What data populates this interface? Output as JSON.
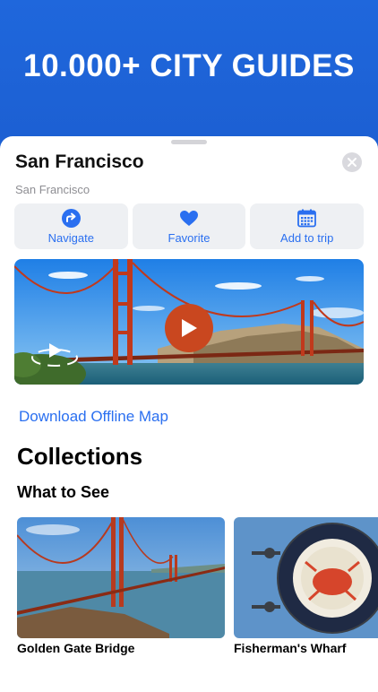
{
  "hero": {
    "title": "10.000+ CITY GUIDES"
  },
  "place": {
    "title": "San Francisco",
    "subtitle": "San Francisco"
  },
  "actions": [
    {
      "label": "Navigate",
      "icon": "navigate-arrow-icon"
    },
    {
      "label": "Favorite",
      "icon": "heart-icon"
    },
    {
      "label": "Add to trip",
      "icon": "calendar-icon"
    }
  ],
  "download": {
    "label": "Download Offline Map"
  },
  "collections": {
    "heading": "Collections",
    "section": "What to See",
    "items": [
      {
        "label": "Golden Gate Bridge"
      },
      {
        "label": "Fisherman's Wharf"
      }
    ]
  },
  "colors": {
    "accent": "#2a6ff0",
    "hero": "#1d63d6",
    "play": "#c9471f"
  }
}
